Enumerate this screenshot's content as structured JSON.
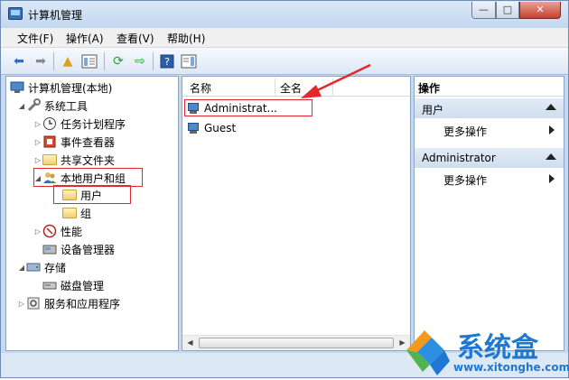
{
  "window": {
    "title": "计算机管理",
    "minimize": "—",
    "maximize": "□",
    "close": "✕"
  },
  "menu": [
    "文件(F)",
    "操作(A)",
    "查看(V)",
    "帮助(H)"
  ],
  "toolbar": {
    "icons": [
      "back-icon",
      "forward-icon",
      "up-folder-icon",
      "show-hide-tree-icon",
      "refresh-icon",
      "export-icon",
      "help-icon",
      "action-pane-icon"
    ]
  },
  "tree": {
    "root": "计算机管理(本地)",
    "system_tools": "系统工具",
    "task_scheduler": "任务计划程序",
    "event_viewer": "事件查看器",
    "shared_folders": "共享文件夹",
    "local_users_groups": "本地用户和组",
    "users": "用户",
    "groups": "组",
    "performance": "性能",
    "device_manager": "设备管理器",
    "storage": "存储",
    "disk_management": "磁盘管理",
    "services_apps": "服务和应用程序"
  },
  "list": {
    "columns": [
      "名称",
      "全名"
    ],
    "rows": [
      {
        "name": "Administrat...",
        "fullname": ""
      },
      {
        "name": "Guest",
        "fullname": ""
      }
    ]
  },
  "actions": {
    "header": "操作",
    "section1": "用户",
    "section1_item": "更多操作",
    "section2": "Administrator",
    "section2_item": "更多操作"
  },
  "watermark": {
    "name": "系统盒",
    "url": "www.xitonghe.com"
  },
  "colors": {
    "highlight": "#e2282e",
    "logo": "#1e78d2"
  }
}
